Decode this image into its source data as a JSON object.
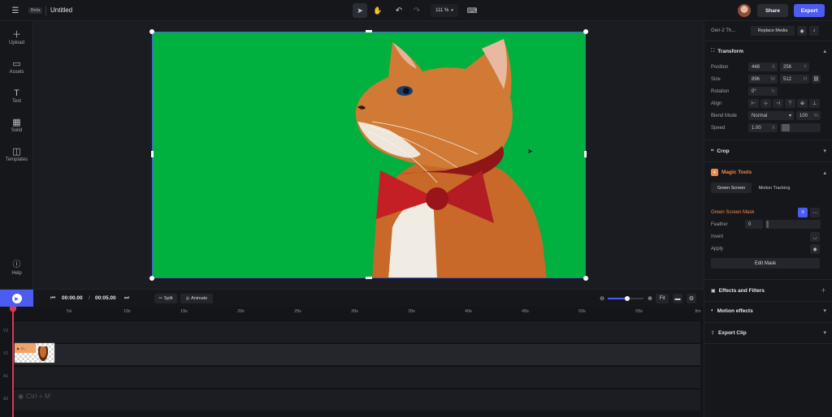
{
  "header": {
    "beta_badge": "Beta",
    "doc_title": "Untitled",
    "zoom": "111 %",
    "share_label": "Share",
    "export_label": "Export"
  },
  "rail": {
    "items": [
      {
        "label": "Upload",
        "icon": "plus-icon"
      },
      {
        "label": "Assets",
        "icon": "folder-icon"
      },
      {
        "label": "Text",
        "icon": "text-icon"
      },
      {
        "label": "Solid",
        "icon": "grid-icon"
      },
      {
        "label": "Templates",
        "icon": "templates-icon"
      }
    ],
    "help_label": "Help"
  },
  "transport": {
    "current": "00:00.00",
    "separator": "/",
    "total": "00:05.00",
    "split_label": "Split",
    "animate_label": "Animate",
    "fit_label": "Fit"
  },
  "ruler": [
    "5s",
    "10s",
    "15s",
    "20s",
    "25s",
    "30s",
    "35s",
    "40s",
    "45s",
    "50s",
    "55s",
    "1m"
  ],
  "tracks": [
    "V2",
    "V1",
    "A1",
    "A2"
  ],
  "clip_label": "0...",
  "shortcut_hint": "Ctrl + M",
  "panel": {
    "gen_label": "Gen-2 Th...",
    "replace_label": "Replace Media",
    "transform_title": "Transform",
    "position_label": "Position",
    "pos_x": "448",
    "pos_y": "256",
    "axis_x": "X",
    "axis_y": "Y",
    "axis_w": "W",
    "axis_h": "H",
    "size_label": "Size",
    "size_w": "896",
    "size_h": "512",
    "rotation_label": "Rotation",
    "rotation_value": "0°",
    "align_label": "Align",
    "blend_label": "Blend Mode",
    "blend_value": "Normal",
    "blend_opacity": "100",
    "percent": "%",
    "speed_label": "Speed",
    "speed_value": "1.00",
    "speed_unit": "X",
    "crop_title": "Crop",
    "magic_title": "Magic Tools",
    "green_screen_tab": "Green Screen",
    "motion_tracking_tab": "Motion Tracking",
    "mask_label": "Green Screen Mask",
    "feather_label": "Feather",
    "feather_value": "0",
    "invert_label": "Invert",
    "apply_label": "Apply",
    "edit_mask_label": "Edit Mask",
    "effects_title": "Effects and Filters",
    "motion_effects_title": "Motion effects",
    "export_clip_title": "Export Clip"
  },
  "colors": {
    "accent": "#4c5cf0",
    "playhead": "#e0364b",
    "green_screen": "#00b140",
    "magic": "#f08a4b"
  }
}
